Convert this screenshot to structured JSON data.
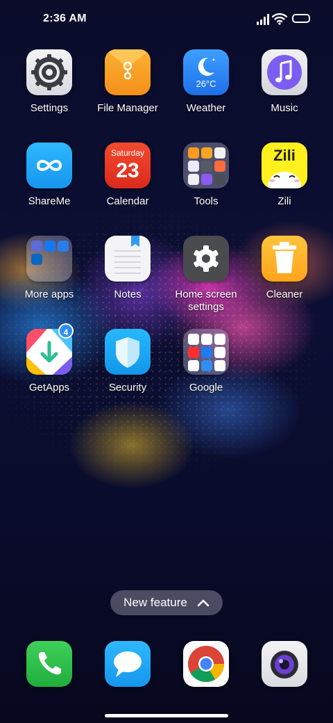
{
  "status": {
    "time": "2:36 AM"
  },
  "apps": {
    "settings": {
      "label": "Settings",
      "icon": "gear-icon"
    },
    "file_manager": {
      "label": "File Manager",
      "icon": "folder-envelope-icon"
    },
    "weather": {
      "label": "Weather",
      "icon": "moon-icon",
      "temp": "26°C"
    },
    "music": {
      "label": "Music",
      "icon": "music-note-icon"
    },
    "shareme": {
      "label": "ShareMe",
      "icon": "infinity-icon"
    },
    "calendar": {
      "label": "Calendar",
      "day_name": "Saturday",
      "day_number": "23"
    },
    "tools": {
      "label": "Tools",
      "icon": "folder-icon"
    },
    "zili": {
      "label": "Zili",
      "icon_text": "Zili"
    },
    "more_apps": {
      "label": "More apps",
      "icon": "folder-icon"
    },
    "notes": {
      "label": "Notes",
      "icon": "notepad-icon"
    },
    "home_screen_settings": {
      "label": "Home screen settings",
      "icon": "gear-icon"
    },
    "cleaner": {
      "label": "Cleaner",
      "icon": "trash-icon"
    },
    "getapps": {
      "label": "GetApps",
      "badge": "4",
      "icon": "download-arrow-icon"
    },
    "security": {
      "label": "Security",
      "icon": "shield-icon"
    },
    "google": {
      "label": "Google",
      "icon": "folder-icon"
    }
  },
  "new_feature": {
    "label": "New feature",
    "icon": "chevron-up-icon"
  },
  "dock": {
    "phone": {
      "icon": "phone-icon"
    },
    "messaging": {
      "icon": "chat-bubble-icon"
    },
    "chrome": {
      "icon": "chrome-icon"
    },
    "camera": {
      "icon": "camera-lens-icon"
    }
  },
  "colors": {
    "wallpaper": "#0b0d30",
    "badge": "#2f8ef0",
    "pill": "#82828f"
  }
}
